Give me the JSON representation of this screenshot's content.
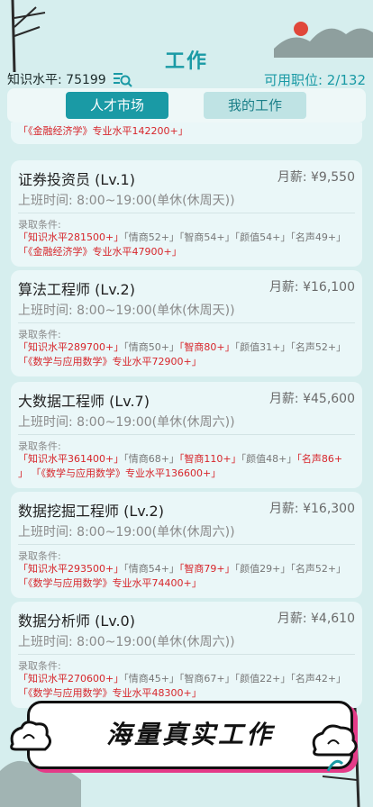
{
  "header": {
    "title": "工作",
    "knowledge_label": "知识水平: 75199",
    "positions_label": "可用职位: 2/132"
  },
  "tabs": [
    {
      "label": "人才市场",
      "active": true
    },
    {
      "label": "我的工作",
      "active": false
    }
  ],
  "partial_card": {
    "req": "「《金融经济学》专业水平142200+」"
  },
  "jobs": [
    {
      "name": "证券投资员 (Lv.1)",
      "salary": "月薪: ¥9,550",
      "hours": "上班时间: 8:00~19:00(单休(休周天))",
      "req_label": "录取条件:",
      "req_line1": [
        {
          "t": "「知识水平281500+」",
          "red": true
        },
        {
          "t": "「情商52+」",
          "red": false
        },
        {
          "t": "「智商54+」",
          "red": false
        },
        {
          "t": "「颜值54+」",
          "red": false
        },
        {
          "t": "「名声49+」",
          "red": false
        }
      ],
      "req_line2": [
        {
          "t": "「《金融经济学》专业水平47900+」",
          "red": true
        }
      ]
    },
    {
      "name": "算法工程师 (Lv.2)",
      "salary": "月薪: ¥16,100",
      "hours": "上班时间: 8:00~19:00(单休(休周天))",
      "req_label": "录取条件:",
      "req_line1": [
        {
          "t": "「知识水平289700+」",
          "red": true
        },
        {
          "t": "「情商50+」",
          "red": false
        },
        {
          "t": "「智商80+」",
          "red": true
        },
        {
          "t": "「颜值31+」",
          "red": false
        },
        {
          "t": "「名声52+」",
          "red": false
        }
      ],
      "req_line2": [
        {
          "t": "「《数学与应用数学》专业水平72900+」",
          "red": true
        }
      ]
    },
    {
      "name": "大数据工程师 (Lv.7)",
      "salary": "月薪: ¥45,600",
      "hours": "上班时间: 8:00~19:00(单休(休周六))",
      "req_label": "录取条件:",
      "req_line1": [
        {
          "t": "「知识水平361400+」",
          "red": true
        },
        {
          "t": "「情商68+」",
          "red": false
        },
        {
          "t": "「智商110+」",
          "red": true
        },
        {
          "t": "「颜值48+」",
          "red": false
        },
        {
          "t": "「名声86+",
          "red": true
        }
      ],
      "req_line2": [
        {
          "t": "」",
          "red": false
        },
        {
          "t": "「《数学与应用数学》专业水平136600+」",
          "red": true
        }
      ]
    },
    {
      "name": "数据挖掘工程师 (Lv.2)",
      "salary": "月薪: ¥16,300",
      "hours": "上班时间: 8:00~19:00(单休(休周六))",
      "req_label": "录取条件:",
      "req_line1": [
        {
          "t": "「知识水平293500+」",
          "red": true
        },
        {
          "t": "「情商54+」",
          "red": false
        },
        {
          "t": "「智商79+」",
          "red": true
        },
        {
          "t": "「颜值29+」",
          "red": false
        },
        {
          "t": "「名声52+」",
          "red": false
        }
      ],
      "req_line2": [
        {
          "t": "「《数学与应用数学》专业水平74400+」",
          "red": true
        }
      ]
    },
    {
      "name": "数据分析师 (Lv.0)",
      "salary": "月薪: ¥4,610",
      "hours": "上班时间: 8:00~19:00(单休(休周六))",
      "req_label": "录取条件:",
      "req_line1": [
        {
          "t": "「知识水平270600+」",
          "red": true
        },
        {
          "t": "「情商45+」",
          "red": false
        },
        {
          "t": "「智商67+」",
          "red": false
        },
        {
          "t": "「颜值22+」",
          "red": false
        },
        {
          "t": "「名声42+」",
          "red": false
        }
      ],
      "req_line2": [
        {
          "t": "「《数学与应用数学》专业水平48300+」",
          "red": true
        }
      ]
    }
  ],
  "banner": {
    "text": "海量真实工作"
  },
  "colors": {
    "accent": "#1a9aa5",
    "background": "#d6eeee",
    "card": "#eaf7f8",
    "requirement_unmet": "#d7262b",
    "banner_shadow": "#e43b88"
  }
}
